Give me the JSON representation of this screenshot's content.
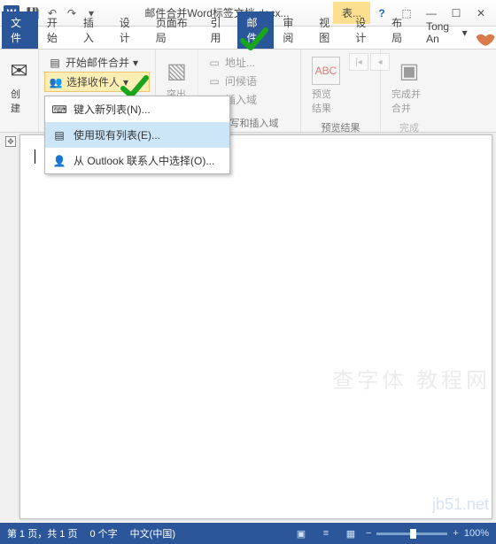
{
  "titlebar": {
    "app_icon": "W",
    "doc_title": "邮件合并Word标签文档.docx...",
    "secondary_title": "表...",
    "qat": {
      "save": "💾",
      "undo": "↶",
      "redo": "↷",
      "customize": "▾"
    },
    "win": {
      "help": "?",
      "full": "⬚",
      "min": "—",
      "max": "☐",
      "close": "✕"
    }
  },
  "tabs_row1": {
    "file": "文件",
    "start": "开始",
    "insert": "插入",
    "design": "设计",
    "layout": "页面布局",
    "references": "引用",
    "mailings": "邮件",
    "review": "审阅",
    "view": "视图"
  },
  "tabs_row2": {
    "design2": "设计",
    "layout2": "布局",
    "user": "Tong An"
  },
  "ribbon": {
    "create": "创建",
    "start_merge": "开始邮件合并",
    "select_recipients": "选择收件人",
    "highlight": "突出显示",
    "address_block": "地址...",
    "greeting": "问候语",
    "insert_field": "插入域",
    "preview": "预览结果",
    "finish": "完成并合并",
    "g_create": "创建",
    "g_write": "撰写和插入域",
    "g_preview": "预览结果",
    "g_finish": "完成"
  },
  "dropdown": {
    "type_new": "键入新列表(N)...",
    "use_existing": "使用现有列表(E)...",
    "from_outlook": "从 Outlook 联系人中选择(O)..."
  },
  "statusbar": {
    "page": "第 1 页，共 1 页",
    "words": "0 个字",
    "lang": "中文(中国)",
    "zoom": "100%"
  },
  "watermark1": "查字体 教程网",
  "watermark2": "jb51.net"
}
